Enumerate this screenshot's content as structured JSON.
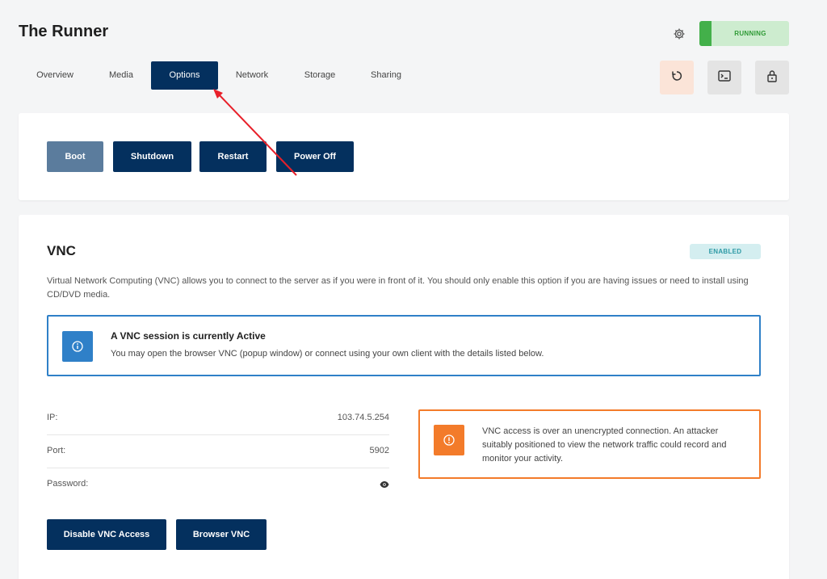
{
  "header": {
    "title": "The Runner",
    "status": "RUNNING",
    "icons": [
      "gear-icon",
      "restart-icon",
      "console-icon",
      "lock-icon"
    ]
  },
  "tabs": [
    {
      "label": "Overview",
      "active": false
    },
    {
      "label": "Media",
      "active": false
    },
    {
      "label": "Options",
      "active": true
    },
    {
      "label": "Network",
      "active": false
    },
    {
      "label": "Storage",
      "active": false
    },
    {
      "label": "Sharing",
      "active": false
    }
  ],
  "power": {
    "boot": "Boot",
    "shutdown": "Shutdown",
    "restart": "Restart",
    "power_off": "Power Off"
  },
  "vnc": {
    "title": "VNC",
    "badge": "ENABLED",
    "description": "Virtual Network Computing (VNC) allows you to connect to the server as if you were in front of it. You should only enable this option if you are having issues or need to install using CD/DVD media.",
    "notice_title": "A VNC session is currently Active",
    "notice_text": "You may open the browser VNC (popup window) or connect using your own client with the details listed below.",
    "ip_label": "IP:",
    "ip_value": "103.74.5.254",
    "port_label": "Port:",
    "port_value": "5902",
    "password_label": "Password:",
    "warning": "VNC access is over an unencrypted connection. An attacker suitably positioned to view the network traffic could record and monitor your activity.",
    "disable_button": "Disable VNC Access",
    "browser_button": "Browser VNC"
  },
  "colors": {
    "primary": "#04305e",
    "boot": "#5b7c9d",
    "running_bar": "#43b04a",
    "running_bg": "#cdeccf",
    "info": "#2f80c8",
    "warning": "#f37b2a",
    "annotation_arrow": "#e8202a"
  }
}
